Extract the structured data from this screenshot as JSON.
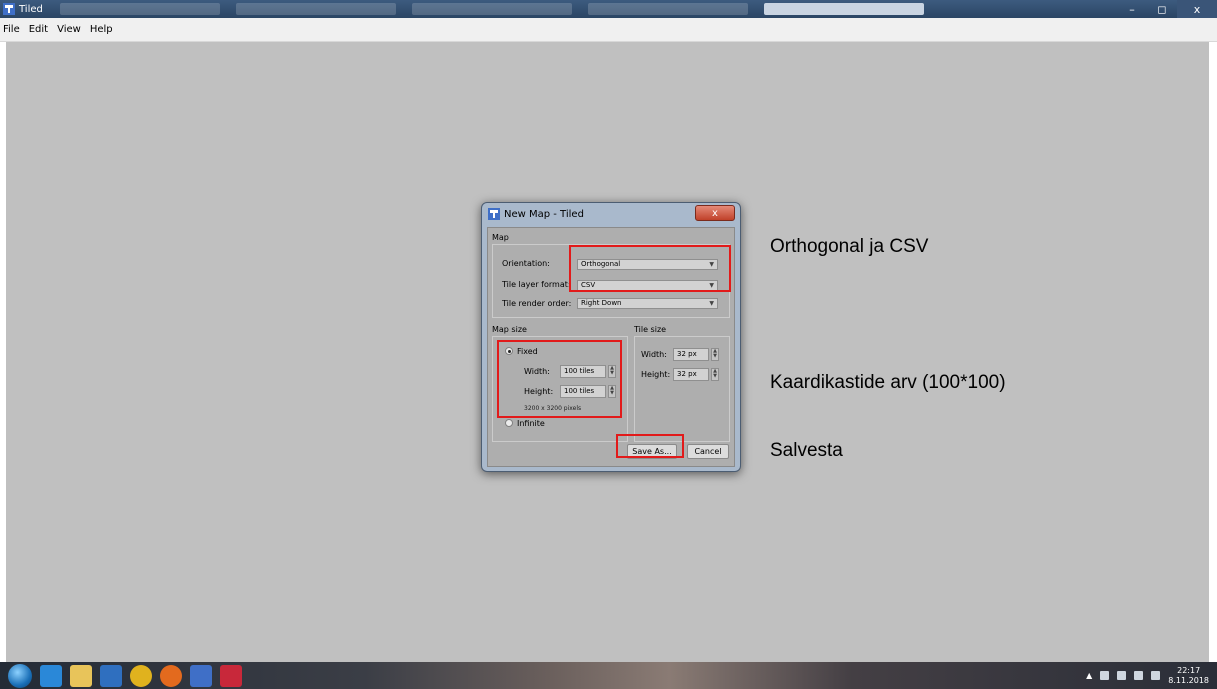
{
  "window": {
    "title": "Tiled",
    "controls": {
      "minimize": "–",
      "maximize": "◻",
      "close": "x"
    }
  },
  "menu": [
    "File",
    "Edit",
    "View",
    "Help"
  ],
  "dialog": {
    "title": "New Map - Tiled",
    "close_label": "x",
    "map_group": {
      "label": "Map",
      "orientation_label": "Orientation:",
      "orientation_value": "Orthogonal",
      "tile_layer_format_label": "Tile layer format:",
      "tile_layer_format_value": "CSV",
      "tile_render_order_label": "Tile render order:",
      "tile_render_order_value": "Right Down"
    },
    "map_size_group": {
      "label": "Map size",
      "fixed_label": "Fixed",
      "width_label": "Width:",
      "width_value": "100 tiles",
      "height_label": "Height:",
      "height_value": "100 tiles",
      "pixels_note": "3200 x 3200 pixels",
      "infinite_label": "Infinite"
    },
    "tile_size_group": {
      "label": "Tile size",
      "width_label": "Width:",
      "width_value": "32 px",
      "height_label": "Height:",
      "height_value": "32 px"
    },
    "save_label": "Save As...",
    "cancel_label": "Cancel"
  },
  "annotations": {
    "orientation_note": "Orthogonal ja CSV",
    "map_size_note": "Kaardikastide arv (100*100)",
    "save_note": "Salvesta"
  },
  "taskbar": {
    "time": "22:17",
    "date": "8.11.2018"
  },
  "colors": {
    "highlight": "#e21a1a",
    "workspace": "#c0c0c0"
  }
}
